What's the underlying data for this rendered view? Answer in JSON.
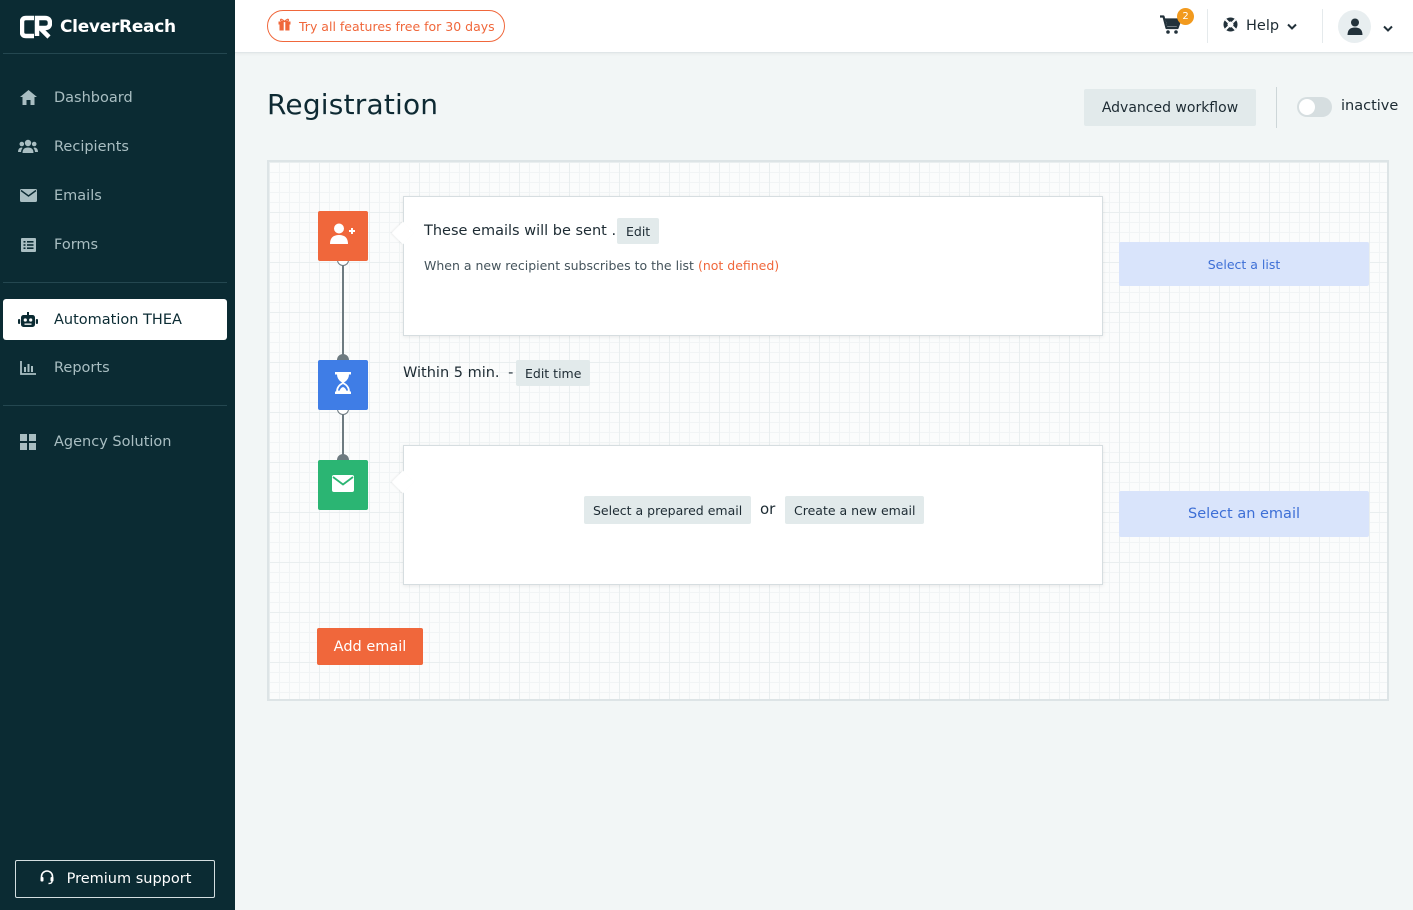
{
  "app": {
    "brand": "CleverReach"
  },
  "sidebar": {
    "items": [
      {
        "label": "Dashboard",
        "icon": "home-icon"
      },
      {
        "label": "Recipients",
        "icon": "users-icon"
      },
      {
        "label": "Emails",
        "icon": "envelope-icon"
      },
      {
        "label": "Forms",
        "icon": "form-icon"
      },
      {
        "label": "Automation THEA",
        "icon": "robot-icon",
        "active": true
      },
      {
        "label": "Reports",
        "icon": "chart-icon"
      },
      {
        "label": "Agency Solution",
        "icon": "grid-icon"
      }
    ],
    "premium_support": "Premium support"
  },
  "topbar": {
    "trial_label": "Try all features free for 30 days",
    "cart_count": "2",
    "help_label": "Help"
  },
  "header": {
    "title": "Registration",
    "advanced_workflow": "Advanced workflow",
    "status": "inactive"
  },
  "workflow": {
    "trigger": {
      "title": "These emails will be sent ...",
      "edit_label": "Edit",
      "condition": "When a new recipient subscribes to the list",
      "condition_value": "(not defined)",
      "side_button": "Select a list"
    },
    "wait": {
      "text": "Within 5 min.",
      "separator": "-",
      "edit_label": "Edit time"
    },
    "email": {
      "select_prepared": "Select a prepared email",
      "or": "or",
      "create_new": "Create a new email",
      "side_button": "Select an email"
    },
    "add_email": "Add email"
  },
  "colors": {
    "sidebar_bg": "#0b2b33",
    "accent_orange": "#f0673b",
    "wait_blue": "#3f7de6",
    "email_green": "#2bb573",
    "side_button_bg": "#d9e4fb",
    "side_button_text": "#3d6fd6"
  }
}
